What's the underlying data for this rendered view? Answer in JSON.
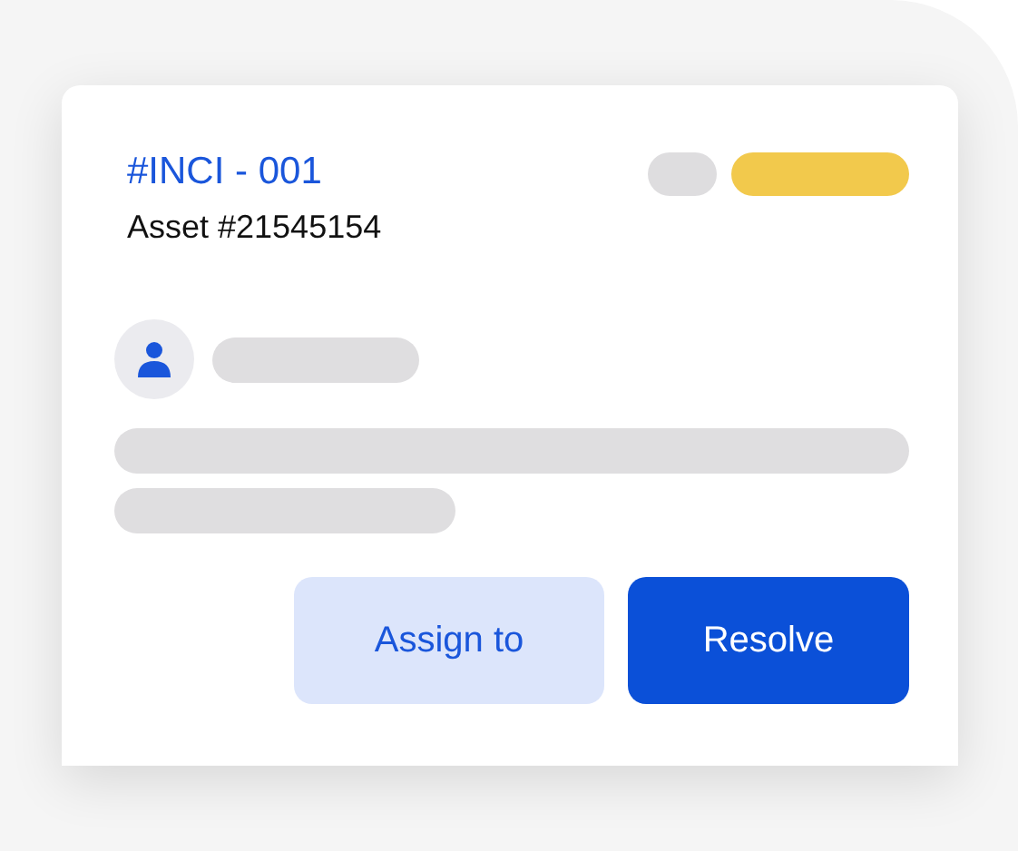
{
  "incident": {
    "title": "#INCI - 001",
    "asset": "Asset #21545154"
  },
  "tags": [
    {
      "color": "#dedddf"
    },
    {
      "color": "#f2c94c"
    }
  ],
  "buttons": [
    {
      "label": "Assign to",
      "kind": "secondary"
    },
    {
      "label": "Resolve",
      "kind": "primary"
    }
  ]
}
